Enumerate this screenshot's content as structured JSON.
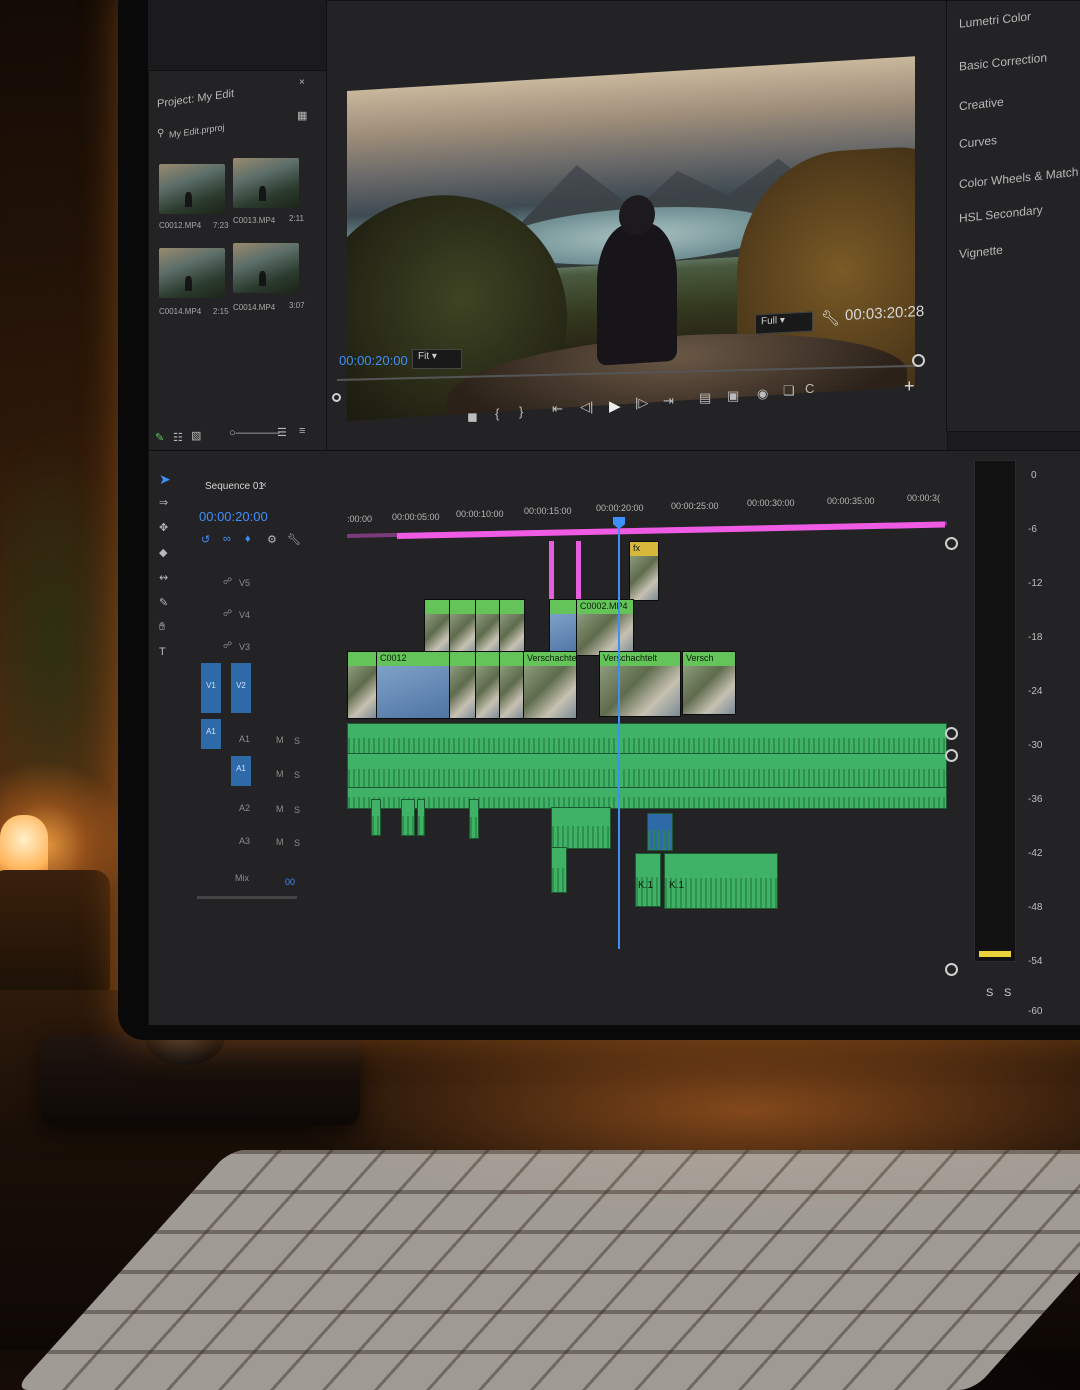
{
  "project": {
    "panel_title": "Project: My Edit",
    "close_label": "×",
    "bin_label": "My Edit.prproj",
    "clips": [
      {
        "name": "C0012.MP4",
        "duration": "7:23"
      },
      {
        "name": "C0013.MP4",
        "duration": "2:11"
      },
      {
        "name": "C0014.MP4",
        "duration": "2:15"
      },
      {
        "name": "C0014.MP4",
        "duration": "3:07"
      }
    ]
  },
  "program": {
    "playhead_timecode": "00:00:20:00",
    "duration_timecode": "00:03:20:28",
    "zoom_select": "Fit",
    "quality_select": "Full"
  },
  "effects": {
    "items": [
      "Lumetri Color",
      "Basic Correction",
      "Creative",
      "Curves",
      "Color Wheels & Match",
      "HSL Secondary",
      "Vignette"
    ]
  },
  "timeline": {
    "sequence_name": "Sequence 01",
    "sequence_timecode": "00:00:20:00",
    "ruler_labels": [
      ":00:00",
      "00:00:05:00",
      "00:00:10:00",
      "00:00:15:00",
      "00:00:20:00",
      "00:00:25:00",
      "00:00:30:00",
      "00:00:35:00",
      "00:00:3("
    ],
    "video_tracks": [
      "V5",
      "V4",
      "V3",
      "V2"
    ],
    "audio_tracks": [
      "A1",
      "A1",
      "A2",
      "A3"
    ],
    "source_tags": [
      "V1",
      "A1"
    ],
    "mix_label": "Mix",
    "mix_value": "00",
    "clip_labels": {
      "v4_clip": "C0002.MP4",
      "v2_clip1": "C0012",
      "v2_nest1": "Verschachtelt",
      "v2_nest2": "Verschachtelt",
      "v2_nest3": "Versch",
      "fx_badge": "fx",
      "k1a": "K.1",
      "k1b": "K.1"
    },
    "track_buttons": {
      "mute": "M",
      "solo": "S"
    }
  },
  "meter": {
    "labels": [
      "0",
      "-6",
      "-12",
      "-18",
      "-24",
      "-30",
      "-36",
      "-42",
      "-48",
      "-54",
      "-60"
    ],
    "solo_left": "S",
    "solo_right": "S"
  }
}
